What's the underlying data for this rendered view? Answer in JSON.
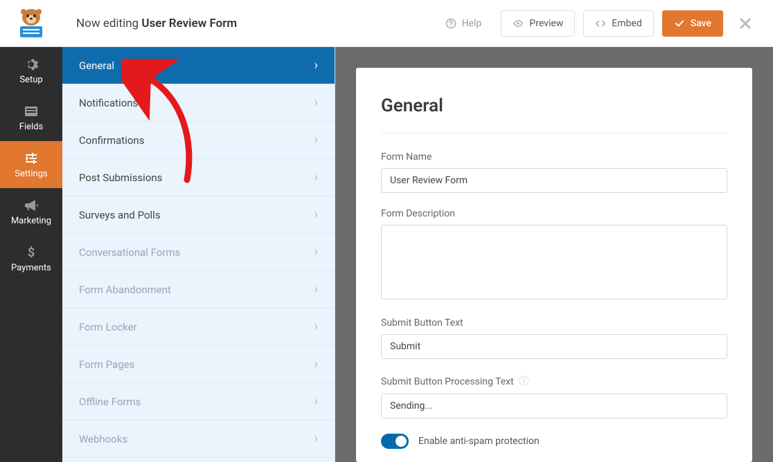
{
  "header": {
    "editing_prefix": "Now editing",
    "form_name": "User Review Form",
    "help_label": "Help",
    "preview_label": "Preview",
    "embed_label": "Embed",
    "save_label": "Save"
  },
  "sidebar": {
    "items": [
      {
        "label": "Setup"
      },
      {
        "label": "Fields"
      },
      {
        "label": "Settings"
      },
      {
        "label": "Marketing"
      },
      {
        "label": "Payments"
      }
    ]
  },
  "panel": {
    "items": [
      {
        "label": "General",
        "state": "selected"
      },
      {
        "label": "Notifications",
        "state": "normal"
      },
      {
        "label": "Confirmations",
        "state": "normal"
      },
      {
        "label": "Post Submissions",
        "state": "normal"
      },
      {
        "label": "Surveys and Polls",
        "state": "normal"
      },
      {
        "label": "Conversational Forms",
        "state": "disabled"
      },
      {
        "label": "Form Abandonment",
        "state": "disabled"
      },
      {
        "label": "Form Locker",
        "state": "disabled"
      },
      {
        "label": "Form Pages",
        "state": "disabled"
      },
      {
        "label": "Offline Forms",
        "state": "disabled"
      },
      {
        "label": "Webhooks",
        "state": "disabled"
      }
    ]
  },
  "main": {
    "heading": "General",
    "form_name_label": "Form Name",
    "form_name_value": "User Review Form",
    "form_description_label": "Form Description",
    "form_description_value": "",
    "submit_text_label": "Submit Button Text",
    "submit_text_value": "Submit",
    "submit_processing_label": "Submit Button Processing Text",
    "submit_processing_value": "Sending...",
    "antispam_label": "Enable anti-spam protection"
  }
}
